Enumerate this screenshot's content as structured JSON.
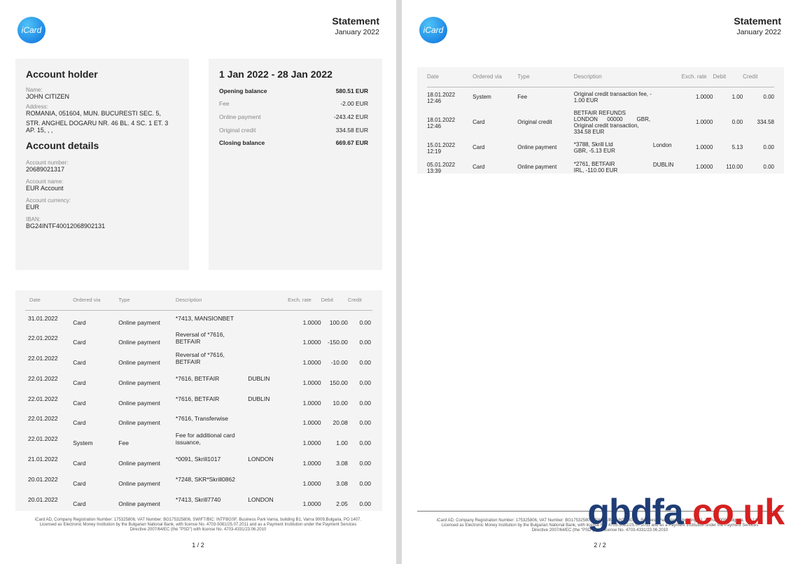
{
  "logo_text": "iCard",
  "statement_title": "Statement",
  "statement_month": "January 2022",
  "account_holder": {
    "heading": "Account holder",
    "name_label": "Name:",
    "name": "JOHN CITIZEN",
    "address_label": "Address:",
    "address_line1": "ROMANIA, 051604, MUN. BUCURESTI SEC. 5,",
    "address_line2": "STR. ANGHEL DOGARU NR. 46 BL. 4 SC. 1 ET. 3",
    "address_line3": "AP. 15, , ,"
  },
  "account_details": {
    "heading": "Account details",
    "number_label": "Account number:",
    "number": "20689021317",
    "name_label": "Account name:",
    "name": "EUR Account",
    "currency_label": "Account currency:",
    "currency": "EUR",
    "iban_label": "IBAN:",
    "iban": "BG24INTF40012068902131"
  },
  "period": {
    "heading": "1 Jan 2022 - 28 Jan 2022",
    "rows": [
      {
        "label": "Opening balance",
        "value": "580.51 EUR"
      },
      {
        "label": "Fee",
        "value": "-2.00 EUR"
      },
      {
        "label": "Online payment",
        "value": "-243.42 EUR"
      },
      {
        "label": "Original credit",
        "value": "334.58 EUR"
      },
      {
        "label": "Closing balance",
        "value": "669.67 EUR"
      }
    ]
  },
  "columns": {
    "date": "Date",
    "ordered_via": "Ordered via",
    "type": "Type",
    "description": "Description",
    "exch_rate": "Exch. rate",
    "debit": "Debit",
    "credit": "Credit"
  },
  "page1_transactions": [
    {
      "date": "31.01.2022",
      "via": "Card",
      "type": "Online payment",
      "desc": "*7413, MANSIONBET",
      "city": "",
      "rate": "1.0000",
      "debit": "100.00",
      "credit": "0.00"
    },
    {
      "date": "22.01.2022",
      "via": "Card",
      "type": "Online payment",
      "desc": "Reversal of *7616, BETFAIR",
      "city": "",
      "rate": "1.0000",
      "debit": "-150.00",
      "credit": "0.00"
    },
    {
      "date": "22.01.2022",
      "via": "Card",
      "type": "Online payment",
      "desc": "Reversal of *7616, BETFAIR",
      "city": "",
      "rate": "1.0000",
      "debit": "-10.00",
      "credit": "0.00"
    },
    {
      "date": "22.01.2022",
      "via": "Card",
      "type": "Online payment",
      "desc": "*7616, BETFAIR",
      "city": "DUBLIN",
      "rate": "1.0000",
      "debit": "150.00",
      "credit": "0.00"
    },
    {
      "date": "22.01.2022",
      "via": "Card",
      "type": "Online payment",
      "desc": "*7616, BETFAIR",
      "city": "DUBLIN",
      "rate": "1.0000",
      "debit": "10.00",
      "credit": "0.00"
    },
    {
      "date": "22.01.2022",
      "via": "Card",
      "type": "Online payment",
      "desc": "*7616, Transferwise",
      "city": "",
      "rate": "1.0000",
      "debit": "20.08",
      "credit": "0.00"
    },
    {
      "date": "22.01.2022",
      "via": "System",
      "type": "Fee",
      "desc": "Fee for additional card issuance,",
      "city": "",
      "rate": "1.0000",
      "debit": "1.00",
      "credit": "0.00"
    },
    {
      "date": "21.01.2022",
      "via": "Card",
      "type": "Online payment",
      "desc": "*0091, Skrill1017",
      "city": "LONDON",
      "rate": "1.0000",
      "debit": "3.08",
      "credit": "0.00"
    },
    {
      "date": "20.01.2022",
      "via": "Card",
      "type": "Online payment",
      "desc": "*7248, SKR*Skrill0862",
      "city": "",
      "rate": "1.0000",
      "debit": "3.08",
      "credit": "0.00"
    },
    {
      "date": "20.01.2022",
      "via": "Card",
      "type": "Online payment",
      "desc": "*7413, Skrill7740",
      "city": "LONDON",
      "rate": "1.0000",
      "debit": "2.05",
      "credit": "0.00"
    }
  ],
  "page2_transactions": [
    {
      "date": "18.01.2022",
      "time": "12:46",
      "via": "System",
      "type": "Fee",
      "desc1": "Original credit transaction fee, -",
      "desc2": "1.00 EUR",
      "desc3": "",
      "desc4": "",
      "city": "",
      "rate": "1.0000",
      "debit": "1.00",
      "credit": "0.00"
    },
    {
      "date": "18.01.2022",
      "time": "12:46",
      "via": "Card",
      "type": "Original credit",
      "desc1": "BETFAIR REFUNDS",
      "desc2": "LONDON      00000         GBR,",
      "desc3": "Original credit transaction,",
      "desc4": "334.58 EUR",
      "city": "",
      "rate": "1.0000",
      "debit": "0.00",
      "credit": "334.58"
    },
    {
      "date": "15.01.2022",
      "time": "12:19",
      "via": "Card",
      "type": "Online payment",
      "desc1": "*3788, Skrill Ltd",
      "desc2": "GBR, -5.13 EUR",
      "desc3": "",
      "desc4": "",
      "city": "London",
      "rate": "1.0000",
      "debit": "5.13",
      "credit": "0.00"
    },
    {
      "date": "05.01.2022",
      "time": "13:39",
      "via": "Card",
      "type": "Online payment",
      "desc1": "*2761, BETFAIR",
      "desc2": "IRL, -110.00 EUR",
      "desc3": "",
      "desc4": "",
      "city": "DUBLIN",
      "rate": "1.0000",
      "debit": "110.00",
      "credit": "0.00"
    }
  ],
  "footer": {
    "line1": "iCard AD, Company Registration Number: 175325806, VAT Number: BG175325806, SWIFT/BIC: INTFBGSF, Business Park Varna, building B1, Varna 9009,Bulgaria, PO 1407.",
    "line2": "Licensed as Electronic Money Institution by the Bulgarian National Bank, with license No. 4703-5081/25.07.2011 and as a Payment Institution under the Payment Services",
    "line3": "Directive 2007/64/EC (the \"PSD\") with license No. 4703-4331/23.06.2010"
  },
  "page1_number": "1 / 2",
  "page2_number": "2 / 2",
  "watermark": {
    "part1": "gbdfa",
    "part2": ".co.uk"
  }
}
